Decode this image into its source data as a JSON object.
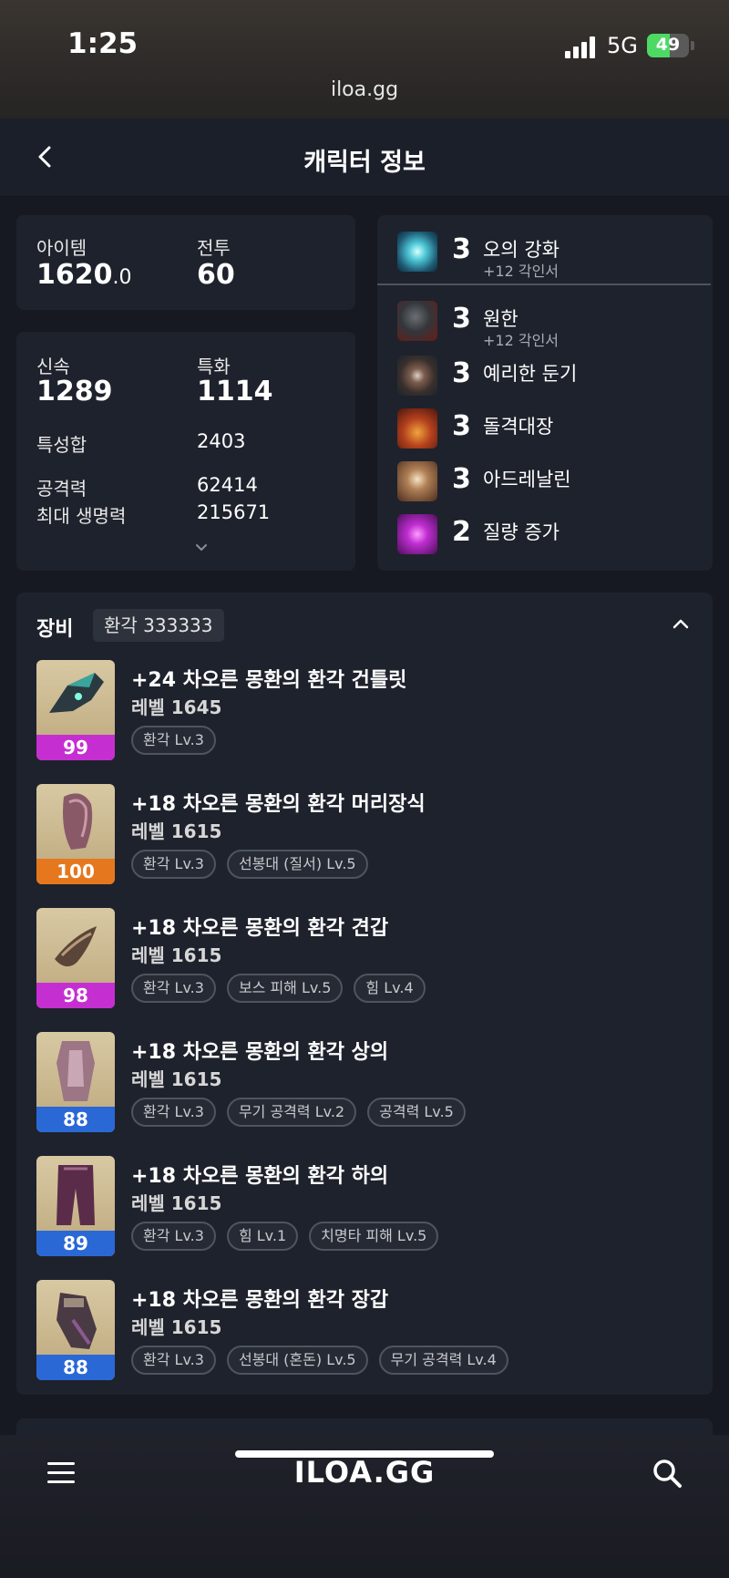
{
  "status": {
    "time": "1:25",
    "network": "5G",
    "battery": "49",
    "url": "iloa.gg"
  },
  "header": {
    "title": "캐릭터 정보"
  },
  "summary": {
    "item_label": "아이템",
    "item_value_main": "1620",
    "item_value_dec": ".0",
    "combat_label": "전투",
    "combat_value": "60"
  },
  "stats": {
    "swiftness_label": "신속",
    "swiftness_value": "1289",
    "crit_label": "특화",
    "crit_value": "1114",
    "total_label": "특성합",
    "total_value": "2403",
    "attack_label": "공격력",
    "attack_value": "62414",
    "hp_label": "최대 생명력",
    "hp_value": "215671"
  },
  "engravings": [
    {
      "level": "3",
      "name": "오의 강화",
      "sub": "+12 각인서",
      "icon": "orb-icon"
    },
    {
      "level": "3",
      "name": "원한",
      "sub": "+12 각인서",
      "icon": "grudge-icon"
    },
    {
      "level": "3",
      "name": "예리한 둔기",
      "sub": "",
      "icon": "blunt-icon"
    },
    {
      "level": "3",
      "name": "돌격대장",
      "sub": "",
      "icon": "raid-captain-icon"
    },
    {
      "level": "3",
      "name": "아드레날린",
      "sub": "",
      "icon": "adrenaline-icon"
    },
    {
      "level": "2",
      "name": "질량 증가",
      "sub": "",
      "icon": "mass-increase-icon"
    }
  ],
  "equipment": {
    "title": "장비",
    "badge": "환각 333333",
    "items": [
      {
        "quality": "99",
        "quality_color": "#c52fd1",
        "name": "+24 차오른 몽환의 환각 건틀릿",
        "level": "레벨 1645",
        "chips": [
          "환각 Lv.3"
        ]
      },
      {
        "quality": "100",
        "quality_color": "#e5781e",
        "name": "+18 차오른 몽환의 환각 머리장식",
        "level": "레벨 1615",
        "chips": [
          "환각 Lv.3",
          "선봉대 (질서) Lv.5"
        ]
      },
      {
        "quality": "98",
        "quality_color": "#c52fd1",
        "name": "+18 차오른 몽환의 환각 견갑",
        "level": "레벨 1615",
        "chips": [
          "환각 Lv.3",
          "보스 피해 Lv.5",
          "힘 Lv.4"
        ]
      },
      {
        "quality": "88",
        "quality_color": "#2a68d6",
        "name": "+18 차오른 몽환의 환각 상의",
        "level": "레벨 1615",
        "chips": [
          "환각 Lv.3",
          "무기 공격력 Lv.2",
          "공격력 Lv.5"
        ]
      },
      {
        "quality": "89",
        "quality_color": "#2a68d6",
        "name": "+18 차오른 몽환의 환각 하의",
        "level": "레벨 1615",
        "chips": [
          "환각 Lv.3",
          "힘 Lv.1",
          "치명타 피해 Lv.5"
        ]
      },
      {
        "quality": "88",
        "quality_color": "#2a68d6",
        "name": "+18 차오른 몽환의 환각 장갑",
        "level": "레벨 1615",
        "chips": [
          "환각 Lv.3",
          "선봉대 (혼돈) Lv.5",
          "무기 공격력 Lv.4"
        ]
      }
    ]
  },
  "bottom_nav": {
    "logo": "ILOA.GG"
  }
}
